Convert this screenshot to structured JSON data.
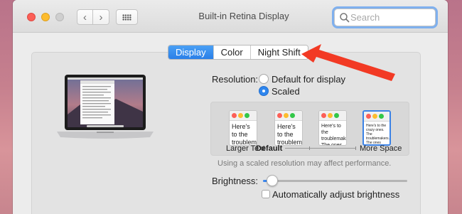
{
  "window": {
    "title": "Built-in Retina Display"
  },
  "search": {
    "placeholder": "Search",
    "value": ""
  },
  "tabs": [
    {
      "label": "Display",
      "active": true
    },
    {
      "label": "Color",
      "active": false
    },
    {
      "label": "Night Shift",
      "active": false
    }
  ],
  "resolution": {
    "label": "Resolution:",
    "options": [
      {
        "label": "Default for display",
        "selected": false
      },
      {
        "label": "Scaled",
        "selected": true
      }
    ]
  },
  "scaled_options": {
    "preview_text": "Here's to the crazy ones. The troublemakers. The ones who see things differently. They're not fond of rules.",
    "preview_text_large": "Here's to the troublem",
    "preview_text_mid": "Here's to the troublemakers. The ones who see t rules. And",
    "labels": {
      "larger": "Larger Text",
      "default": "Default",
      "more": "More Space"
    },
    "selected_index": 3
  },
  "note": "Using a scaled resolution may affect performance.",
  "brightness": {
    "label": "Brightness:",
    "level": 0.05
  },
  "auto_brightness": {
    "label": "Automatically adjust brightness",
    "checked": false
  },
  "colors": {
    "accent": "#2f86ee",
    "annotation_arrow": "#f23a24"
  }
}
